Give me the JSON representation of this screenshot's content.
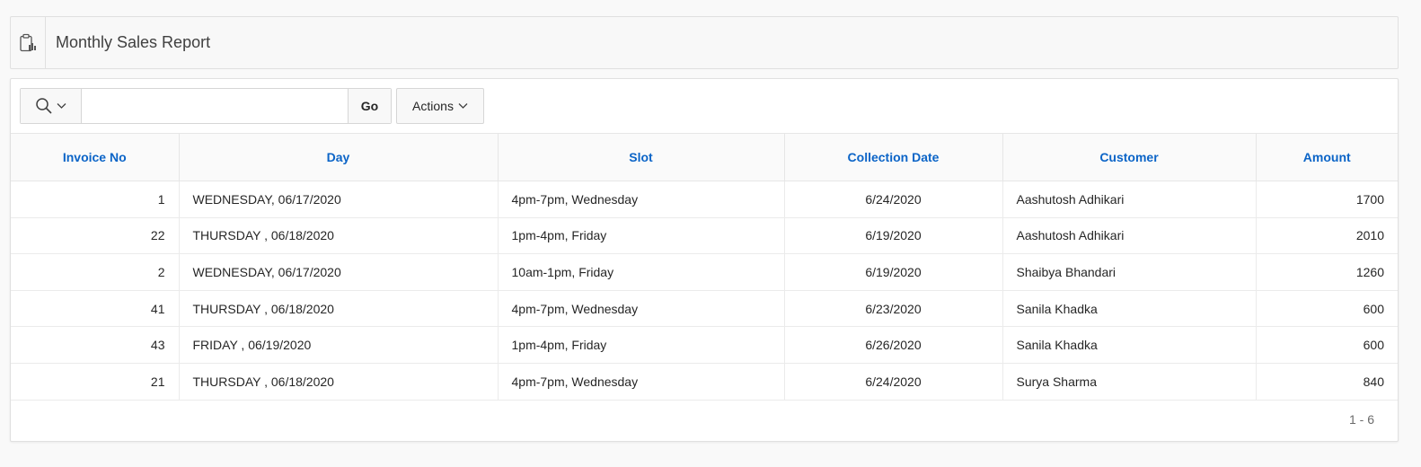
{
  "region": {
    "title": "Monthly Sales Report",
    "icon": "clipboard-chart-icon"
  },
  "toolbar": {
    "search_icon": "search-icon",
    "search_value": "",
    "go_label": "Go",
    "actions_label": "Actions"
  },
  "table": {
    "columns": [
      "Invoice No",
      "Day",
      "Slot",
      "Collection Date",
      "Customer",
      "Amount"
    ],
    "rows": [
      {
        "invoice": "1",
        "day": "WEDNESDAY, 06/17/2020",
        "slot": "4pm-7pm, Wednesday",
        "collection_date": "6/24/2020",
        "customer": "Aashutosh Adhikari",
        "amount": "1700"
      },
      {
        "invoice": "22",
        "day": "THURSDAY , 06/18/2020",
        "slot": "1pm-4pm, Friday",
        "collection_date": "6/19/2020",
        "customer": "Aashutosh Adhikari",
        "amount": "2010"
      },
      {
        "invoice": "2",
        "day": "WEDNESDAY, 06/17/2020",
        "slot": "10am-1pm, Friday",
        "collection_date": "6/19/2020",
        "customer": "Shaibya Bhandari",
        "amount": "1260"
      },
      {
        "invoice": "41",
        "day": "THURSDAY , 06/18/2020",
        "slot": "4pm-7pm, Wednesday",
        "collection_date": "6/23/2020",
        "customer": "Sanila Khadka",
        "amount": "600"
      },
      {
        "invoice": "43",
        "day": "FRIDAY , 06/19/2020",
        "slot": "1pm-4pm, Friday",
        "collection_date": "6/26/2020",
        "customer": "Sanila Khadka",
        "amount": "600"
      },
      {
        "invoice": "21",
        "day": "THURSDAY , 06/18/2020",
        "slot": "4pm-7pm, Wednesday",
        "collection_date": "6/24/2020",
        "customer": "Surya Sharma",
        "amount": "840"
      }
    ]
  },
  "pagination": "1 - 6",
  "colors": {
    "header_link": "#0b64c7",
    "border": "#e0e0e0"
  }
}
